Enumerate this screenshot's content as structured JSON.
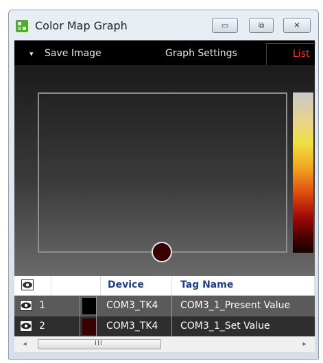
{
  "window": {
    "title": "Color Map Graph",
    "minimize_glyph": "▭",
    "restore_glyph": "⧉",
    "close_glyph": "✕"
  },
  "toolbar": {
    "save_arrow": "▾",
    "save_label": "Save Image",
    "settings_label": "Graph Settings",
    "list_label": "List"
  },
  "graph": {
    "colorbar_icon": "gradient-colorbar",
    "marker_color": "#3a0000"
  },
  "table": {
    "columns": [
      "",
      "",
      "Device",
      "Tag Name"
    ],
    "rows": [
      {
        "index": "1",
        "color": "#000000",
        "device": "COM3_TK4",
        "tag": "COM3_1_Present Value"
      },
      {
        "index": "2",
        "color": "#3a0000",
        "device": "COM3_TK4",
        "tag": "COM3_1_Set Value"
      }
    ]
  },
  "scrollbar": {
    "left_arrow": "◂",
    "right_arrow": "▸",
    "thumb_grip": "III"
  },
  "colors": {
    "list_accent": "#ff2a2a",
    "header_text": "#1f3f8f",
    "row_1_bg": "#5a5a5a",
    "row_2_bg": "#2e2e2e"
  }
}
